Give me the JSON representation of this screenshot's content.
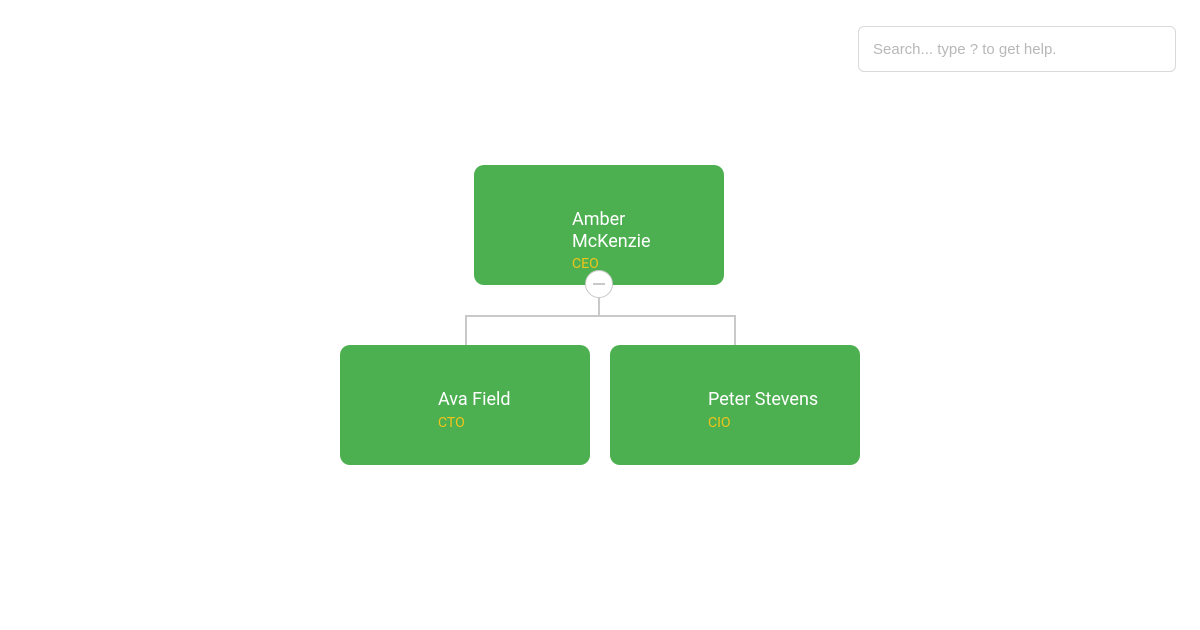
{
  "search": {
    "placeholder": "Search... type ? to get help.",
    "value": ""
  },
  "org": {
    "root": {
      "name": "Amber McKenzie",
      "title": "CEO"
    },
    "children": [
      {
        "name": "Ava Field",
        "title": "CTO"
      },
      {
        "name": "Peter Stevens",
        "title": "CIO"
      }
    ]
  },
  "colors": {
    "node_bg": "#4caf50",
    "node_name": "#ffffff",
    "node_title": "#f0c41b",
    "connector": "#c9c9c9"
  }
}
